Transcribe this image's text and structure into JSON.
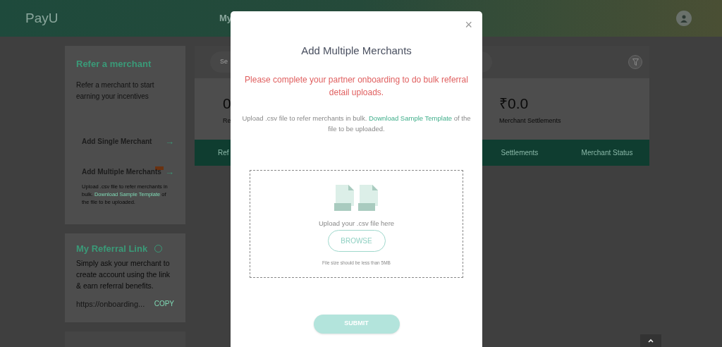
{
  "header": {
    "logo": "PayU",
    "nav_item": "My"
  },
  "refer_card": {
    "title": "Refer a merchant",
    "description": "Refer a merchant to start earning your incentives",
    "actions": [
      {
        "label": "Add Single Merchant",
        "new_badge": false,
        "arrow": "→"
      },
      {
        "label": "Add Multiple Merchants",
        "new_badge": true,
        "arrow": "→",
        "note_before": "Upload .csv file to refer merchants in bulk.",
        "note_link": "Download Sample Template",
        "note_after": "of the file to be uploaded."
      }
    ]
  },
  "referral_card": {
    "title": "My Referral Link",
    "description": "Simply ask your merchant to create account using the link & earn referral benefits.",
    "link": "https://onboarding...",
    "copy": "COPY"
  },
  "search": {
    "placeholder": "Se"
  },
  "stats": [
    {
      "value": "0",
      "label": "Re"
    },
    {
      "value": "₹0.0",
      "label": "Merchant Settlements"
    }
  ],
  "table": {
    "columns": [
      "Ref",
      "Settlements",
      "Merchant Status"
    ]
  },
  "modal": {
    "close": "×",
    "title": "Add Multiple Merchants",
    "warning": "Please complete your partner onboarding to do bulk referral detail uploads.",
    "info_before": "Upload .csv file to refer merchants in bulk.",
    "info_link": "Download Sample Template",
    "info_after": "of the file to be uploaded.",
    "dropzone": {
      "label": "Upload your .csv file here",
      "browse": "BROWSE",
      "note": "File size should be less than 5MB"
    },
    "submit": {
      "label": "SUBMIT",
      "disabled": true
    }
  }
}
